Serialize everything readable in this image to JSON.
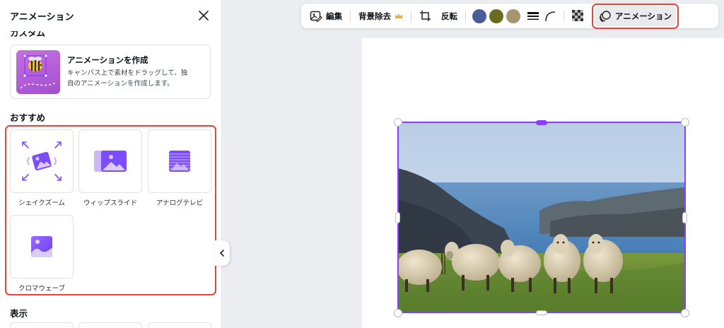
{
  "panel": {
    "title": "アニメーション",
    "cut_heading": "カスタム",
    "create": {
      "title": "アニメーションを作成",
      "description_line1": "キャンバス上で素材をドラッグして、独",
      "description_line2": "自のアニメーションを作成します。"
    },
    "recommended": {
      "title": "おすすめ",
      "items": [
        {
          "label": "シェイクズーム",
          "icon": "shake-zoom-icon"
        },
        {
          "label": "ウィップスライド",
          "icon": "whip-slide-icon"
        },
        {
          "label": "アナログテレビ",
          "icon": "analog-tv-icon"
        },
        {
          "label": "クロマウェーブ",
          "icon": "chroma-wave-icon"
        }
      ]
    },
    "display_section_title": "表示"
  },
  "toolbar": {
    "edit_label": "編集",
    "bg_remove_label": "背景除去",
    "flip_label": "反転",
    "animation_label": "アニメーション",
    "swatches": [
      "#4a5c99",
      "#6b6b1f",
      "#a99470"
    ]
  },
  "colors": {
    "accent_purple": "#8b3dff",
    "highlight_red": "#e0473c",
    "crown_gold": "#f2a93b"
  }
}
